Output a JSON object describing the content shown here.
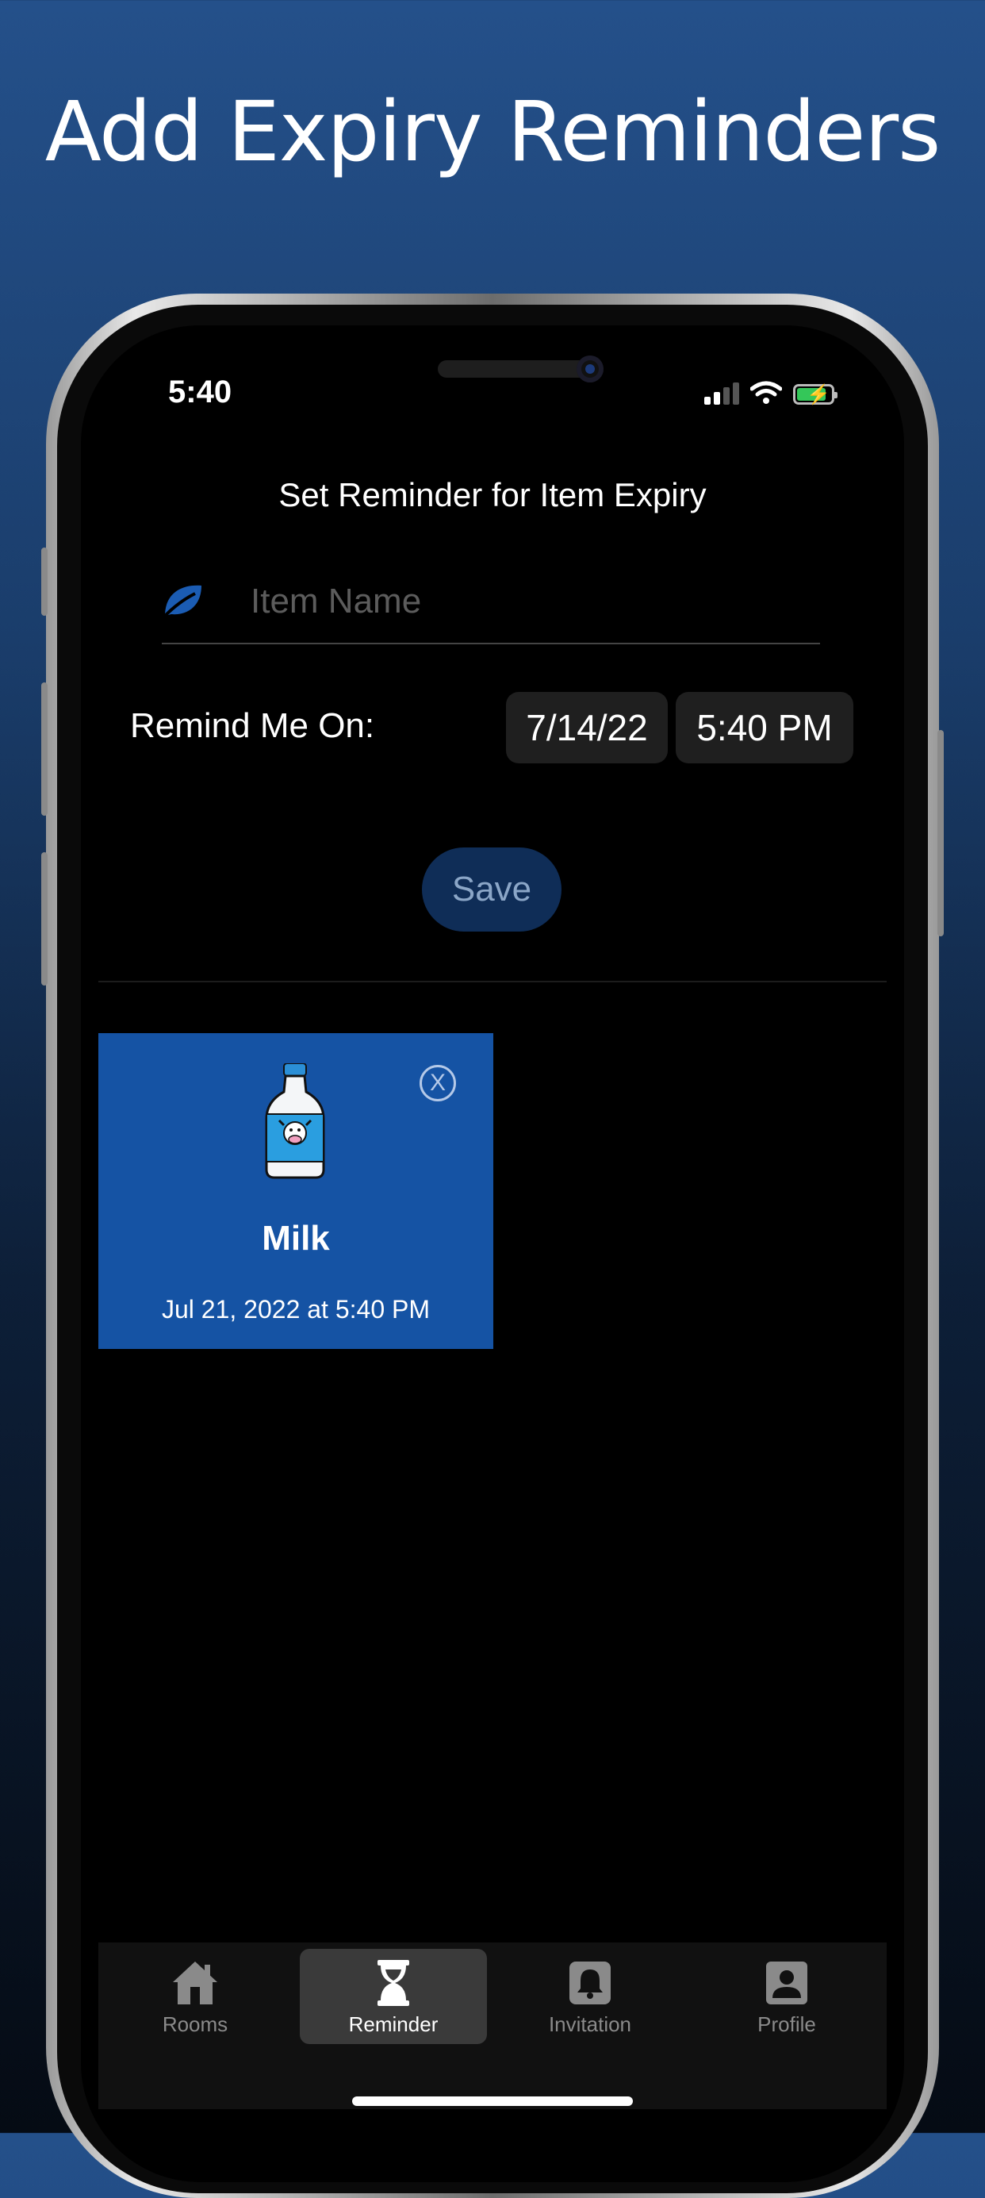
{
  "headline": "Add Expiry Reminders",
  "status_bar": {
    "time": "5:40"
  },
  "screen": {
    "title": "Set Reminder for Item Expiry",
    "item_name_placeholder": "Item Name",
    "item_name_value": "",
    "remind_label": "Remind Me On:",
    "date_value": "7/14/22",
    "time_value": "5:40 PM",
    "save_label": "Save"
  },
  "reminders": [
    {
      "name": "Milk",
      "datetime": "Jul 21, 2022 at 5:40 PM",
      "close_label": "X",
      "icon": "milk-bottle-icon"
    }
  ],
  "tabs": [
    {
      "label": "Rooms",
      "icon": "house-icon",
      "active": false
    },
    {
      "label": "Reminder",
      "icon": "hourglass-icon",
      "active": true
    },
    {
      "label": "Invitation",
      "icon": "bell-icon",
      "active": false
    },
    {
      "label": "Profile",
      "icon": "person-badge-icon",
      "active": false
    }
  ],
  "colors": {
    "accent_blue": "#1553a4",
    "save_bg": "#0f2d57",
    "battery_green": "#34c759"
  }
}
